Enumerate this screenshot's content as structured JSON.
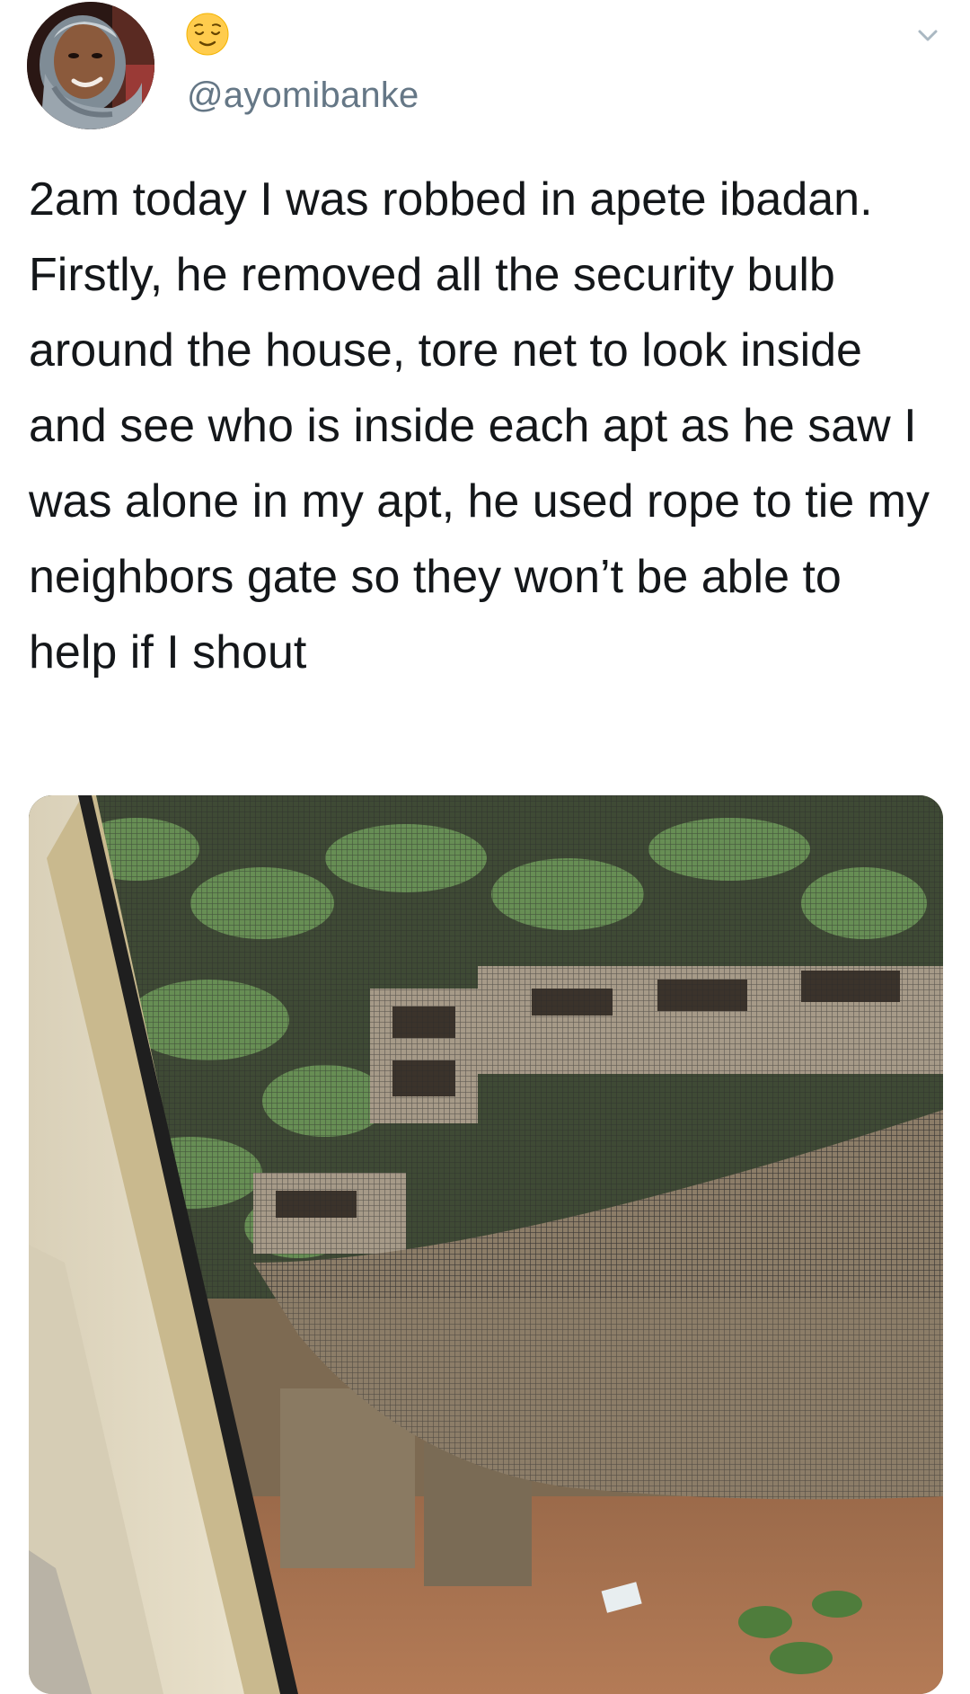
{
  "tweet": {
    "author": {
      "avatar_icon": "user-avatar",
      "display_emoji_icon": "relieved-face-emoji",
      "handle": "@ayomibanke"
    },
    "menu_icon": "chevron-down-icon",
    "text": "2am today I was robbed in apete ibadan. Firstly, he removed all the security bulb  around the house, tore net to look inside and see who is inside each apt as he saw I was alone in my apt, he used rope to tie my neighbors gate so they won’t be able to help if I shout",
    "media": {
      "type": "photo"
    }
  },
  "colors": {
    "text": "#14171a",
    "secondary_text": "#657786",
    "chevron": "#aab8c2",
    "background": "#ffffff"
  }
}
